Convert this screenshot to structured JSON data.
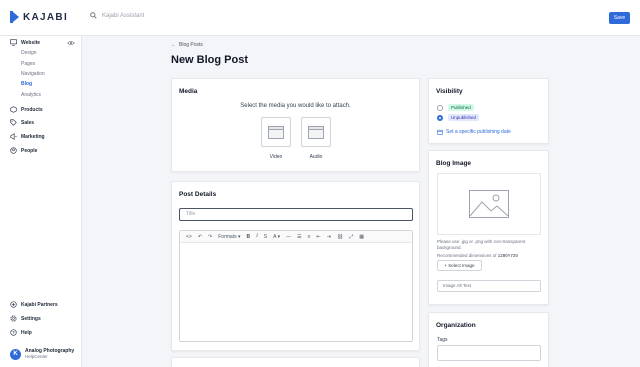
{
  "app": {
    "logo_text": "KAJABI",
    "search_placeholder": "Kajabi Assistant",
    "save_label": "Save",
    "brand_color": "#2e6bd9"
  },
  "sidebar": {
    "website": "Website",
    "website_sub": [
      "Design",
      "Pages",
      "Navigation",
      "Blog",
      "Analytics"
    ],
    "active_sub": "Blog",
    "items": [
      {
        "label": "Products",
        "icon": "products-icon"
      },
      {
        "label": "Sales",
        "icon": "tag-icon"
      },
      {
        "label": "Marketing",
        "icon": "megaphone-icon"
      },
      {
        "label": "People",
        "icon": "people-icon"
      }
    ],
    "bottom": [
      {
        "label": "Kajabi Partners",
        "icon": "partners-icon"
      },
      {
        "label": "Settings",
        "icon": "gear-icon"
      },
      {
        "label": "Help",
        "icon": "help-icon"
      }
    ],
    "org": {
      "name": "Analog Photography",
      "sub": "HelpCenter",
      "initial": "K"
    }
  },
  "main": {
    "back_link": "Blog Posts",
    "page_title": "New Blog Post",
    "media": {
      "title": "Media",
      "prompt": "Select the media you would like to attach.",
      "options": [
        "Video",
        "Audio"
      ]
    },
    "post_details": {
      "title": "Post Details",
      "title_placeholder": "Title",
      "toolbar": [
        "<>",
        "↶",
        "↷",
        "Formats ▾",
        "B",
        "I",
        "S",
        "A ▾",
        "—",
        "☰",
        "≡",
        "⇤",
        "⇥",
        "⛓",
        "⤢",
        "▦"
      ]
    }
  },
  "right": {
    "visibility": {
      "title": "Visibility",
      "options": [
        {
          "label": "Published",
          "checked": false
        },
        {
          "label": "Unpublished",
          "checked": true
        }
      ],
      "schedule_link": "Set a specific publishing date"
    },
    "blog_image": {
      "title": "Blog Image",
      "help_1": "Please use .jpg or .png with non-transparent background.",
      "help_2_prefix": "Recommended dimensions of ",
      "help_2_value": "1280×720",
      "select_label": "+ Select Image",
      "alt_placeholder": "Image Alt Text"
    },
    "organization": {
      "title": "Organization",
      "tags_label": "Tags"
    }
  }
}
